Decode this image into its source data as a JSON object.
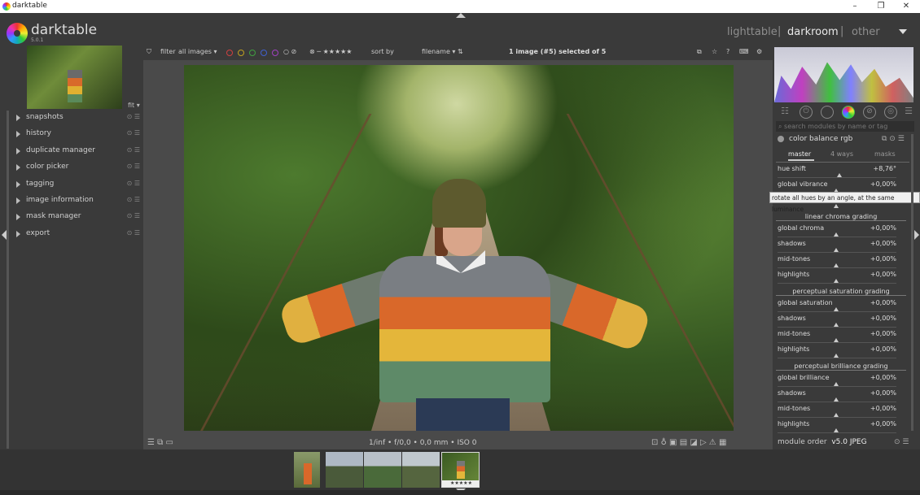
{
  "window": {
    "title": "darktable",
    "minimize": "–",
    "maximize": "❐",
    "close": "✕"
  },
  "app": {
    "name": "darktable",
    "version": "5.0.1"
  },
  "views": {
    "lighttable": "lighttable",
    "darkroom": "darkroom",
    "other": "other",
    "separator": "|"
  },
  "left_panel": {
    "fit_label": "fit",
    "modules": [
      {
        "label": "snapshots"
      },
      {
        "label": "history"
      },
      {
        "label": "duplicate manager"
      },
      {
        "label": "color picker"
      },
      {
        "label": "tagging"
      },
      {
        "label": "image information"
      },
      {
        "label": "mask manager"
      },
      {
        "label": "export"
      }
    ]
  },
  "filter_bar": {
    "filter_label": "filter",
    "filter_value": "all images",
    "sort_label": "sort by",
    "sort_value": "filename",
    "selection_info": "1 image (#5) selected of 5",
    "color_labels": [
      "#d04040",
      "#c0a020",
      "#40a040",
      "#4060d0",
      "#a040c0"
    ]
  },
  "info_bar": {
    "exif": "1/inf • f/0,0 • 0,0 mm • ISO 0"
  },
  "right_panel": {
    "search_placeholder": "search modules by name or tag",
    "module_name": "color balance rgb",
    "tabs": [
      "master",
      "4 ways",
      "masks"
    ],
    "tooltip": "rotate all hues by an angle, at the same luminance",
    "sliders_top": [
      {
        "label": "hue shift",
        "value": "+8,76°"
      },
      {
        "label": "global vibrance",
        "value": "+0,00%"
      }
    ],
    "sections": [
      {
        "title": "linear chroma grading",
        "sliders": [
          {
            "label": "global chroma",
            "value": "+0,00%"
          },
          {
            "label": "shadows",
            "value": "+0,00%"
          },
          {
            "label": "mid-tones",
            "value": "+0,00%"
          },
          {
            "label": "highlights",
            "value": "+0,00%"
          }
        ]
      },
      {
        "title": "perceptual saturation grading",
        "sliders": [
          {
            "label": "global saturation",
            "value": "+0,00%"
          },
          {
            "label": "shadows",
            "value": "+0,00%"
          },
          {
            "label": "mid-tones",
            "value": "+0,00%"
          },
          {
            "label": "highlights",
            "value": "+0,00%"
          }
        ]
      },
      {
        "title": "perceptual brilliance grading",
        "sliders": [
          {
            "label": "global brilliance",
            "value": "+0,00%"
          },
          {
            "label": "shadows",
            "value": "+0,00%"
          },
          {
            "label": "mid-tones",
            "value": "+0,00%"
          },
          {
            "label": "highlights",
            "value": "+0,00%"
          }
        ]
      }
    ],
    "module_order_label": "module order",
    "module_order_value": "v5.0 JPEG"
  },
  "filmstrip": {
    "rating": "★★★★★"
  }
}
